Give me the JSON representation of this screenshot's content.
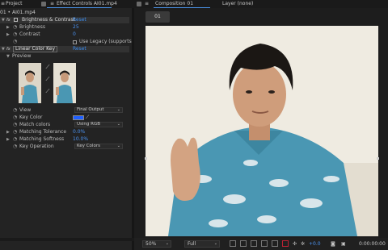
{
  "left_panel": {
    "tabs": {
      "project": "Project",
      "effect_controls": "Effect Controls AI01.mp4"
    },
    "comp_path": "01 • AI01.mp4",
    "brightness_contrast": {
      "name": "Brightness & Contrast",
      "reset": "Reset",
      "brightness_label": "Brightness",
      "brightness_value": "25",
      "contrast_label": "Contrast",
      "contrast_value": "0",
      "legacy_label": "Use Legacy (supports"
    },
    "linear_color_key": {
      "name": "Linear Color Key",
      "reset": "Reset",
      "preview_label": "Preview",
      "view_label": "View",
      "view_value": "Final Output",
      "key_color_label": "Key Color",
      "key_color_swatch": "#1f5fff",
      "match_colors_label": "Match colors",
      "match_colors_value": "Using RGB",
      "matching_tolerance_label": "Matching Tolerance",
      "matching_tolerance_value": "0.0%",
      "matching_softness_label": "Matching Softness",
      "matching_softness_value": "10.0%",
      "key_operation_label": "Key Operation",
      "key_operation_value": "Key Colors"
    }
  },
  "right_panel": {
    "tabs": {
      "composition": "Composition 01",
      "layer": "Layer (none)"
    },
    "comp_button": "01",
    "bottom_bar": {
      "zoom": "50%",
      "resolution": "Full",
      "exposure": "+0.0",
      "timecode": "0:00:00:00"
    }
  },
  "colors": {
    "accent_blue": "#4a90e2",
    "shirt": "#4a97b3",
    "background_wall": "#efebe1"
  }
}
